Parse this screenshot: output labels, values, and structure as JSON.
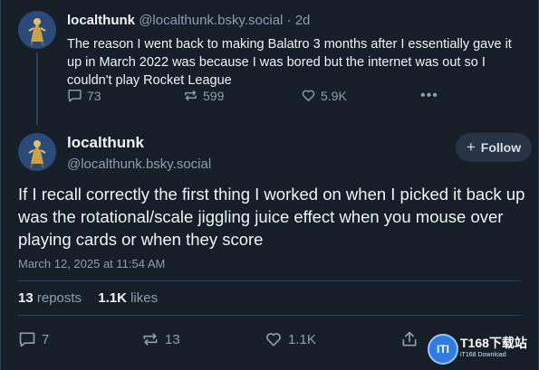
{
  "parent_post": {
    "display_name": "localthunk",
    "handle": "@localthunk.bsky.social",
    "separator": "·",
    "age": "2d",
    "text": "The reason I went back to making Balatro 3 months after I essentially gave it up in March 2022 was because I was bored but the internet was out so I couldn't play Rocket League",
    "replies": "73",
    "reposts": "599",
    "likes": "5.9K",
    "more": "•••"
  },
  "main_post": {
    "display_name": "localthunk",
    "handle": "@localthunk.bsky.social",
    "follow_plus": "+",
    "follow_label": "Follow",
    "text": "If I recall correctly the first thing I worked on when I picked it back up was the rotational/scale jiggling juice effect when you mouse over playing cards or when they score",
    "timestamp": "March 12, 2025 at 11:54 AM",
    "repost_count": "13",
    "repost_label": "reposts",
    "like_count": "1.1K",
    "like_label": "likes",
    "action_replies": "7",
    "action_reposts": "13",
    "action_likes": "1.1K"
  },
  "watermark": {
    "badge": "ITI",
    "main": "T168下载站",
    "sub": "iT168 Download"
  },
  "icons": [
    "reply-icon",
    "repost-icon",
    "like-icon",
    "more-icon",
    "share-icon",
    "plus-icon"
  ],
  "colors": {
    "background": "#161e27",
    "text": "#f1f3f5",
    "muted": "#8f9db0",
    "divider": "#2e4052",
    "follow_bg": "#263444"
  }
}
